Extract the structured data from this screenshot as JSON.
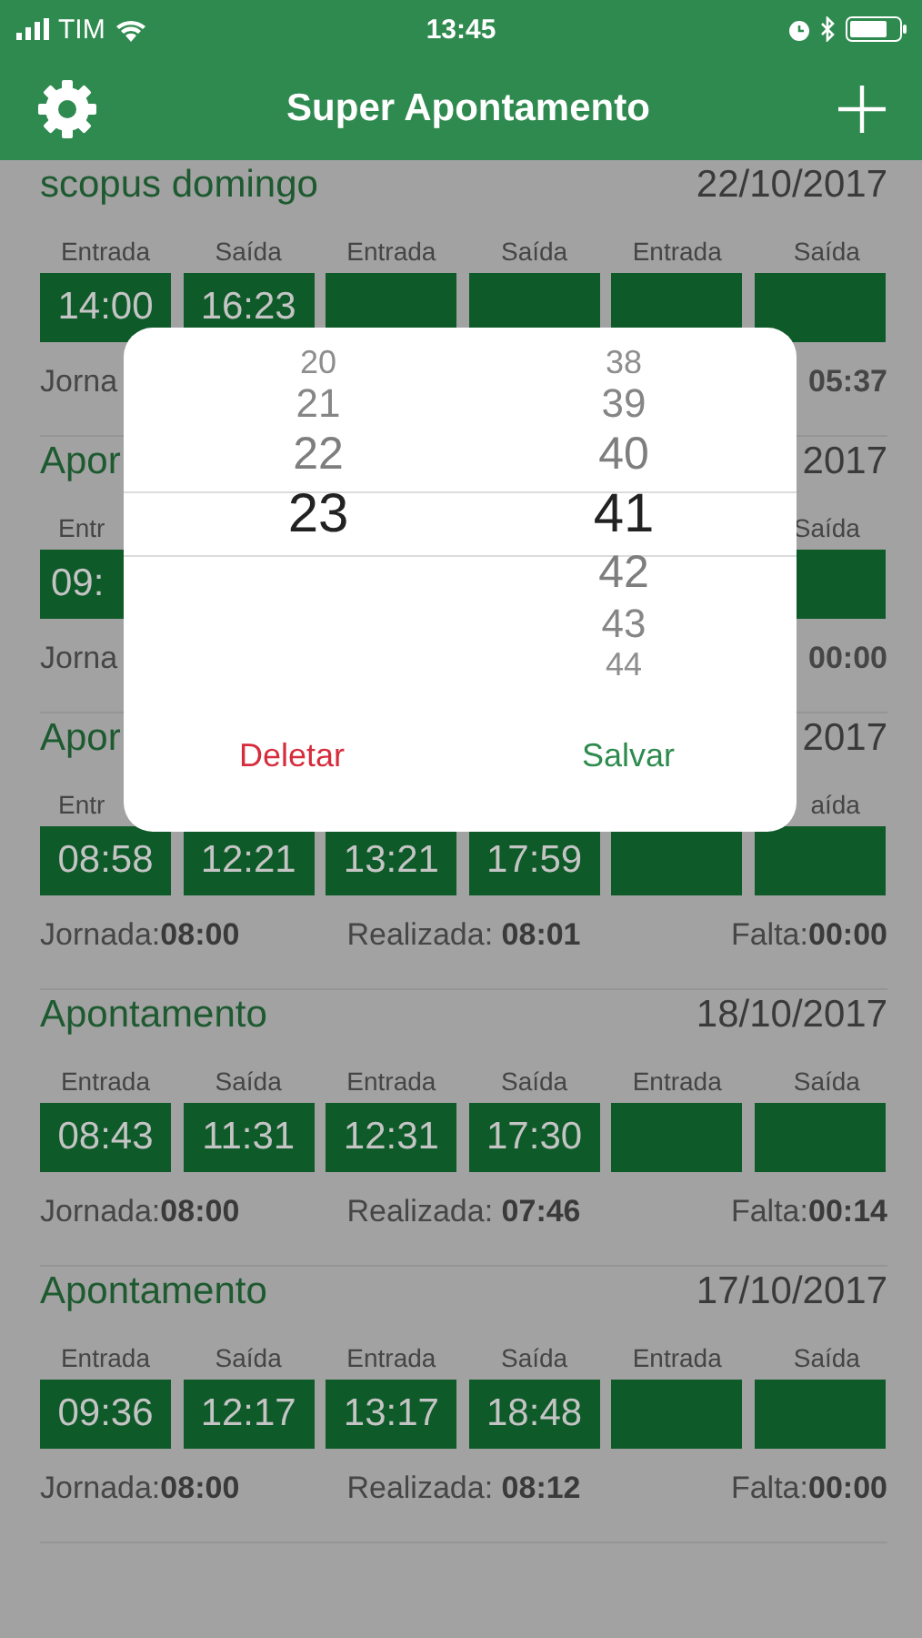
{
  "status_bar": {
    "carrier": "TIM",
    "time": "13:45"
  },
  "nav": {
    "title": "Super Apontamento"
  },
  "records": [
    {
      "title": "scopus domingo",
      "date": "22/10/2017",
      "labels": [
        {
          "kind": "label",
          "text": "Entrada"
        },
        {
          "kind": "label",
          "text": "Saída"
        },
        {
          "kind": "label",
          "text": "Entrada"
        },
        {
          "kind": "label",
          "text": "Saída"
        },
        {
          "kind": "label",
          "text": "Entrada"
        },
        {
          "kind": "label",
          "text": "Saída"
        }
      ],
      "cells": [
        {
          "kind": "time",
          "value": "14:00"
        },
        {
          "kind": "time",
          "value": "16:23"
        },
        {
          "kind": "blank"
        },
        {
          "kind": "blank"
        },
        {
          "kind": "blank"
        },
        {
          "kind": "blank"
        }
      ],
      "footer": [
        {
          "kind": "left",
          "text": "Jorna"
        },
        {
          "kind": "right",
          "text": "05:37",
          "bold": true
        }
      ]
    },
    {
      "title": "Apor",
      "date": "2017",
      "labels": [
        {
          "kind": "partial",
          "text": "Entr"
        },
        {
          "kind": "covered"
        },
        {
          "kind": "covered"
        },
        {
          "kind": "covered"
        },
        {
          "kind": "covered"
        },
        {
          "kind": "label",
          "text": "Saída"
        }
      ],
      "cells": [
        {
          "kind": "partial",
          "value": "09:"
        },
        {
          "kind": "covered"
        },
        {
          "kind": "covered"
        },
        {
          "kind": "covered"
        },
        {
          "kind": "covered"
        },
        {
          "kind": "blank"
        }
      ],
      "footer": [
        {
          "kind": "left",
          "text": "Jorna"
        },
        {
          "kind": "right",
          "text": "00:00",
          "bold": true
        }
      ]
    },
    {
      "title": "Apor",
      "date": "2017",
      "labels": [
        {
          "kind": "partial",
          "text": "Entr"
        },
        {
          "kind": "covered"
        },
        {
          "kind": "covered"
        },
        {
          "kind": "covered"
        },
        {
          "kind": "covered"
        },
        {
          "kind": "label",
          "text": "aída"
        }
      ],
      "cells": [
        {
          "kind": "time",
          "value": "08:58"
        },
        {
          "kind": "time",
          "value": "12:21"
        },
        {
          "kind": "time",
          "value": "13:21"
        },
        {
          "kind": "time",
          "value": "17:59"
        },
        {
          "kind": "blank"
        },
        {
          "kind": "blank"
        }
      ],
      "footer": [
        {
          "kind": "left",
          "text": "Jornada:**08:00**"
        },
        {
          "kind": "center",
          "text": "Realizada: **08:01**"
        },
        {
          "kind": "right",
          "text": "Falta:**00:00**"
        }
      ]
    },
    {
      "title": "Apontamento",
      "date": "18/10/2017",
      "labels": [
        {
          "kind": "label",
          "text": "Entrada"
        },
        {
          "kind": "label",
          "text": "Saída"
        },
        {
          "kind": "label",
          "text": "Entrada"
        },
        {
          "kind": "label",
          "text": "Saída"
        },
        {
          "kind": "label",
          "text": "Entrada"
        },
        {
          "kind": "label",
          "text": "Saída"
        }
      ],
      "cells": [
        {
          "kind": "time",
          "value": "08:43"
        },
        {
          "kind": "time",
          "value": "11:31"
        },
        {
          "kind": "time",
          "value": "12:31"
        },
        {
          "kind": "time",
          "value": "17:30"
        },
        {
          "kind": "blank"
        },
        {
          "kind": "blank"
        }
      ],
      "footer": [
        {
          "kind": "left",
          "text": "Jornada:**08:00**"
        },
        {
          "kind": "center",
          "text": "Realizada: **07:46**"
        },
        {
          "kind": "right",
          "text": "Falta:**00:14**"
        }
      ]
    },
    {
      "title": "Apontamento",
      "date": "17/10/2017",
      "labels": [
        {
          "kind": "label",
          "text": "Entrada"
        },
        {
          "kind": "label",
          "text": "Saída"
        },
        {
          "kind": "label",
          "text": "Entrada"
        },
        {
          "kind": "label",
          "text": "Saída"
        },
        {
          "kind": "label",
          "text": "Entrada"
        },
        {
          "kind": "label",
          "text": "Saída"
        }
      ],
      "cells": [
        {
          "kind": "time",
          "value": "09:36"
        },
        {
          "kind": "time",
          "value": "12:17"
        },
        {
          "kind": "time",
          "value": "13:17"
        },
        {
          "kind": "time",
          "value": "18:48"
        },
        {
          "kind": "blank"
        },
        {
          "kind": "blank"
        }
      ],
      "footer": [
        {
          "kind": "left",
          "text": "Jornada:**08:00**"
        },
        {
          "kind": "center",
          "text": "Realizada: **08:12**"
        },
        {
          "kind": "right",
          "text": "Falta:**00:00**"
        }
      ]
    }
  ],
  "picker": {
    "columns": [
      {
        "items": [
          {
            "value": "20",
            "selected": false
          },
          {
            "value": "21",
            "selected": false
          },
          {
            "value": "22",
            "selected": false
          },
          {
            "value": "23",
            "selected": true
          }
        ]
      },
      {
        "items": [
          {
            "value": "38",
            "selected": false
          },
          {
            "value": "39",
            "selected": false
          },
          {
            "value": "40",
            "selected": false
          },
          {
            "value": "41",
            "selected": true
          },
          {
            "value": "42",
            "selected": false
          },
          {
            "value": "43",
            "selected": false
          },
          {
            "value": "44",
            "selected": false
          }
        ]
      }
    ],
    "buttons": [
      {
        "label": "Deletar",
        "kind": "destructive"
      },
      {
        "label": "Salvar",
        "kind": "confirm"
      }
    ]
  }
}
